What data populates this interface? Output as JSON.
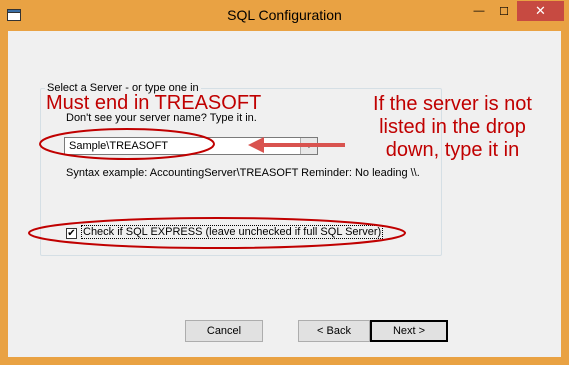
{
  "window": {
    "title": "SQL Configuration",
    "minimize_glyph": "—",
    "maximize_glyph": "☐",
    "close_glyph": "✕",
    "frame_color": "#e9a243"
  },
  "group": {
    "legend": "Select a Server - or type one in",
    "hint": "Don't see your server name?  Type it in.",
    "server_value": "Sample\\TREASOFT",
    "syntax": "Syntax example: AccountingServer\\TREASOFT    Reminder: No leading \\\\.",
    "checkbox_checked": true,
    "checkbox_mark": "✔",
    "checkbox_label": "Check if SQL EXPRESS (leave unchecked if full SQL Server)"
  },
  "annotations": {
    "left": "Must end in TREASOFT",
    "right": "If the server is not listed in the drop down, type it in",
    "color": "#c00000"
  },
  "buttons": {
    "cancel": "Cancel",
    "back": "< Back",
    "next": "Next >"
  }
}
